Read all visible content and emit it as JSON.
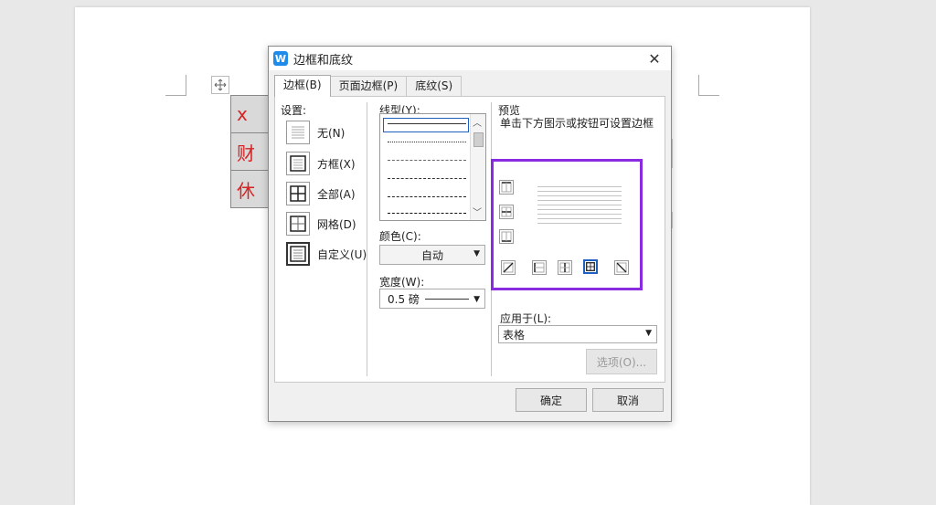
{
  "document": {
    "table_cells": [
      "x",
      "财",
      "休"
    ]
  },
  "dialog": {
    "title": "边框和底纹",
    "app_icon_letter": "W",
    "close_glyph": "✕",
    "tabs": [
      {
        "label": "边框(B)",
        "active": true
      },
      {
        "label": "页面边框(P)",
        "active": false
      },
      {
        "label": "底纹(S)",
        "active": false
      }
    ],
    "settings": {
      "label": "设置:",
      "items": [
        {
          "label": "无(N)",
          "icon": "border-none-icon",
          "selected": false
        },
        {
          "label": "方框(X)",
          "icon": "border-box-icon",
          "selected": false
        },
        {
          "label": "全部(A)",
          "icon": "border-all-icon",
          "selected": false
        },
        {
          "label": "网格(D)",
          "icon": "border-grid-icon",
          "selected": false
        },
        {
          "label": "自定义(U)",
          "icon": "border-custom-icon",
          "selected": true
        }
      ]
    },
    "line_style": {
      "label": "线型(Y):"
    },
    "color": {
      "label": "颜色(C):",
      "value": "自动"
    },
    "width": {
      "label": "宽度(W):",
      "value": "0.5 磅"
    },
    "preview": {
      "label": "预览",
      "hint": "单击下方图示或按钮可设置边框"
    },
    "apply_to": {
      "label": "应用于(L):",
      "value": "表格"
    },
    "options_button": "选项(O)...",
    "ok_button": "确定",
    "cancel_button": "取消",
    "accent_color": "#8a2be2"
  }
}
